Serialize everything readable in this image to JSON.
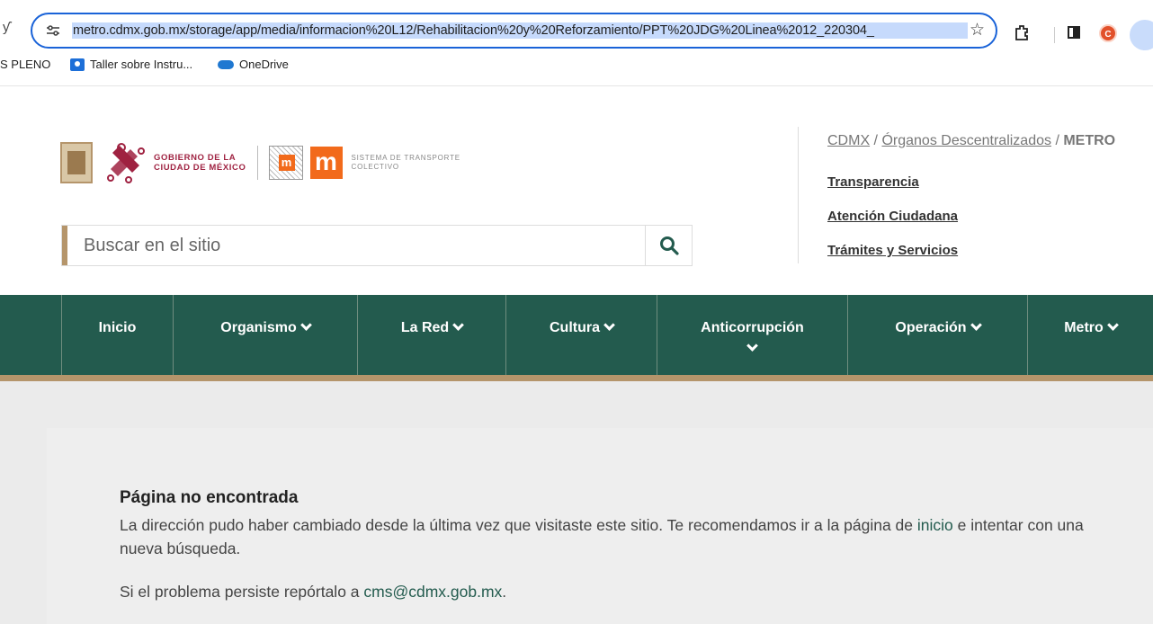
{
  "browser": {
    "url": "metro.cdmx.gob.mx/storage/app/media/informacion%20L12/Rehabilitacion%20y%20Reforzamiento/PPT%20JDG%20Linea%2012_220304_",
    "profile_initial": "C",
    "bookmarks": [
      {
        "label": "S PLENO"
      },
      {
        "label": "Taller sobre Instru..."
      },
      {
        "label": "OneDrive"
      }
    ]
  },
  "header": {
    "gov_line1": "GOBIERNO DE LA",
    "gov_line2": "CIUDAD DE MÉXICO",
    "stc_line1": "SISTEMA DE TRANSPORTE",
    "stc_line2": "COLECTIVO",
    "search_placeholder": "Buscar en el sitio",
    "breadcrumb": {
      "cdmx": "CDMX",
      "sep": " / ",
      "organos": "Órganos Descentralizados",
      "metro": "METRO"
    },
    "links": [
      "Transparencia",
      "Atención Ciudadana",
      "Trámites y Servicios"
    ]
  },
  "nav": {
    "items": [
      "Inicio",
      "Organismo",
      "La Red",
      "Cultura",
      "Anticorrupción",
      "Operación",
      "Metro"
    ]
  },
  "main": {
    "title": "Página no encontrada",
    "text_before": "La dirección pudo haber cambiado desde la última vez que visitaste este sitio. Te recomendamos ir a la página de ",
    "inicio_link": "inicio",
    "text_after": " e intentar con una nueva búsqueda.",
    "report_text": "Si el problema persiste repórtalo a ",
    "email": "cms@cdmx.gob.mx",
    "report_end": "."
  },
  "colors": {
    "nav_green": "#235b4e",
    "gold": "#b5956b",
    "guinda": "#9f2241",
    "metro_orange": "#f26a1b"
  }
}
